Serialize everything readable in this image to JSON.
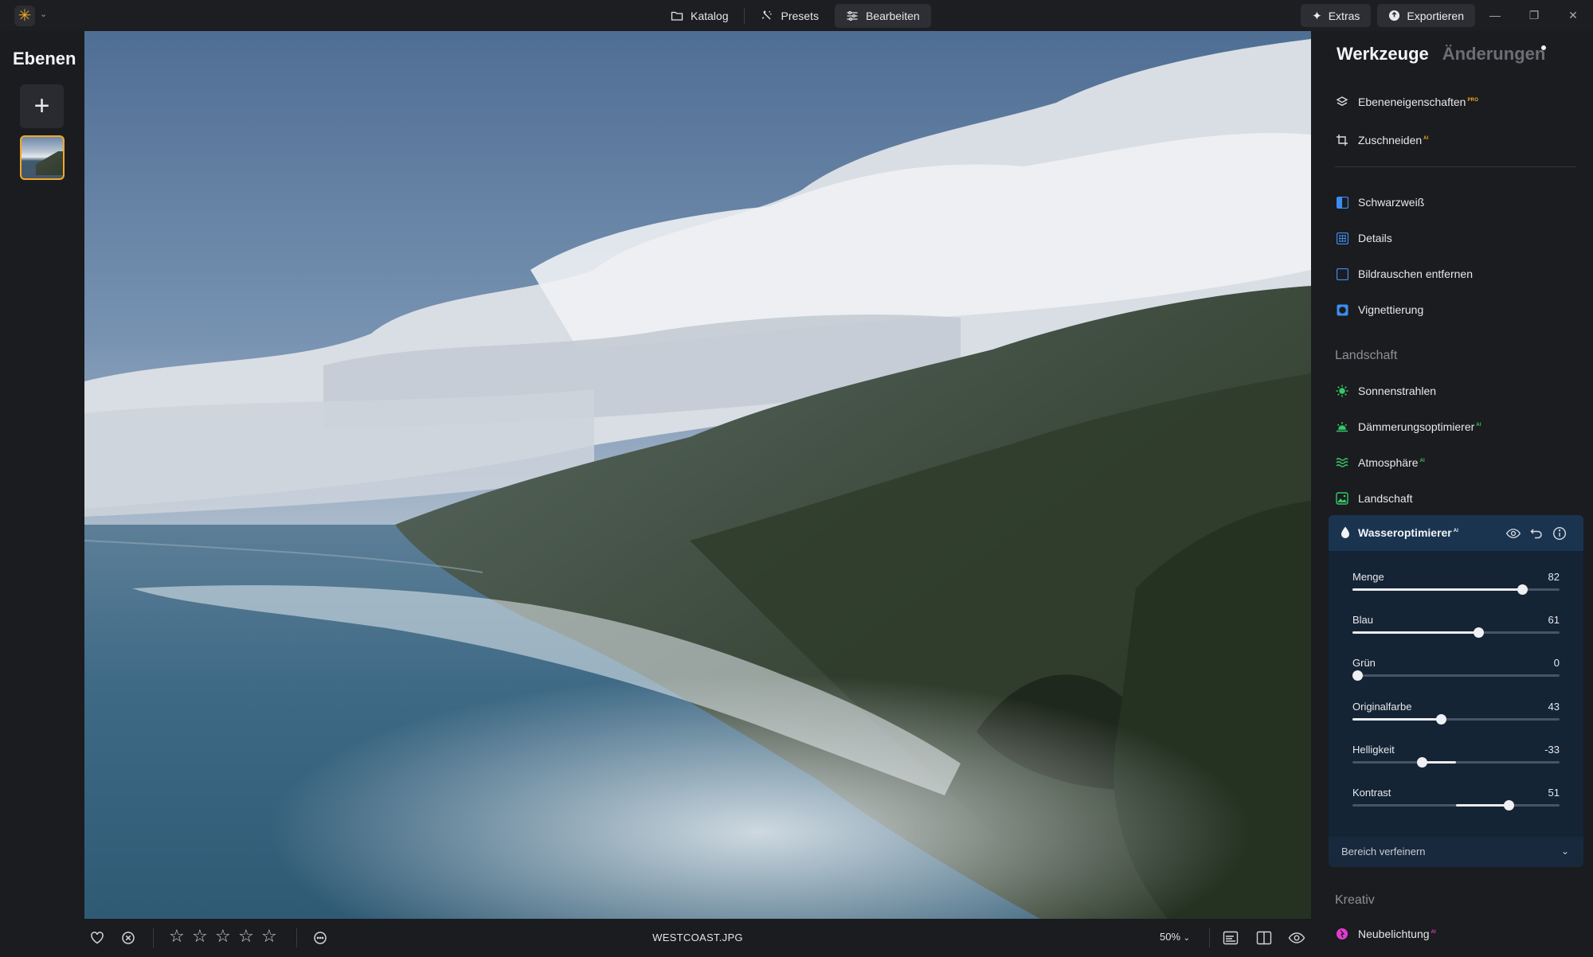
{
  "titlebar": {
    "modes": [
      {
        "label": "Katalog",
        "icon": "folder-icon",
        "active": false
      },
      {
        "label": "Presets",
        "icon": "sparkle-icon",
        "active": false
      },
      {
        "label": "Bearbeiten",
        "icon": "sliders-icon",
        "active": true
      }
    ],
    "extras_label": "Extras",
    "export_label": "Exportieren",
    "accent_color": "#f2a922"
  },
  "layers": {
    "title": "Ebenen"
  },
  "bottombar": {
    "filename": "WESTCOAST.JPG",
    "zoom": "50%",
    "rating_stars": 5
  },
  "tools": {
    "tabs": {
      "active": "Werkzeuge",
      "inactive": "Änderungen"
    },
    "top_items": [
      {
        "label": "Ebeneneigenschaften",
        "badge": "PRO",
        "icon": "layers-icon"
      },
      {
        "label": "Zuschneiden",
        "badge": "AI",
        "icon": "crop-icon"
      }
    ],
    "essential_items": [
      {
        "label": "Schwarzweiß",
        "icon": "bw-icon"
      },
      {
        "label": "Details",
        "icon": "details-icon"
      },
      {
        "label": "Bildrauschen entfernen",
        "icon": "denoise-icon"
      },
      {
        "label": "Vignettierung",
        "icon": "vignette-icon"
      }
    ],
    "landscape_section": "Landschaft",
    "landscape_items": [
      {
        "label": "Sonnenstrahlen",
        "badge": "",
        "icon": "sun-icon"
      },
      {
        "label": "Dämmerungsoptimierer",
        "badge": "AI",
        "icon": "sunrise-icon"
      },
      {
        "label": "Atmosphäre",
        "badge": "AI",
        "icon": "waves-icon"
      },
      {
        "label": "Landschaft",
        "badge": "",
        "icon": "landscape-icon"
      }
    ],
    "water": {
      "title": "Wasseroptimierer",
      "badge": "AI",
      "sliders": [
        {
          "label": "Menge",
          "value": "82",
          "num": 82,
          "min": 0,
          "max": 100
        },
        {
          "label": "Blau",
          "value": "61",
          "num": 61,
          "min": 0,
          "max": 100
        },
        {
          "label": "Grün",
          "value": "0",
          "num": 0,
          "min": 0,
          "max": 100
        },
        {
          "label": "Originalfarbe",
          "value": "43",
          "num": 43,
          "min": 0,
          "max": 100
        },
        {
          "label": "Helligkeit",
          "value": "-33",
          "num": -33,
          "min": -100,
          "max": 100
        },
        {
          "label": "Kontrast",
          "value": "51",
          "num": 51,
          "min": -100,
          "max": 100
        }
      ],
      "refine_label": "Bereich verfeinern"
    },
    "creative_section": "Kreativ",
    "creative_items": [
      {
        "label": "Neubelichtung",
        "badge": "AI",
        "icon": "relight-icon"
      }
    ]
  }
}
